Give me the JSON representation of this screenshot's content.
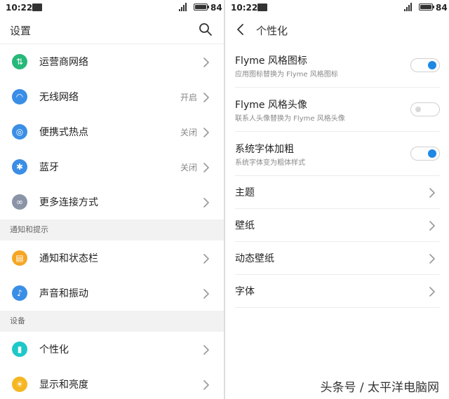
{
  "status_bar": {
    "time": "10:22",
    "battery": "84"
  },
  "left": {
    "title": "设置",
    "items": [
      {
        "label": "运营商网络",
        "value": "",
        "icon": "mobile-data-icon",
        "color": "#27b87a"
      },
      {
        "label": "无线网络",
        "value": "开启",
        "icon": "wifi-icon",
        "color": "#3a8ee6"
      },
      {
        "label": "便携式热点",
        "value": "关闭",
        "icon": "hotspot-icon",
        "color": "#3a8ee6"
      },
      {
        "label": "蓝牙",
        "value": "关闭",
        "icon": "bluetooth-icon",
        "color": "#3a8ee6"
      },
      {
        "label": "更多连接方式",
        "value": "",
        "icon": "link-icon",
        "color": "#8a94a6"
      }
    ],
    "section_notify": "通知和提示",
    "notify_items": [
      {
        "label": "通知和状态栏",
        "icon": "notification-icon",
        "color": "#f5a623"
      },
      {
        "label": "声音和振动",
        "icon": "volume-icon",
        "color": "#3a8ee6"
      }
    ],
    "section_device": "设备",
    "device_items": [
      {
        "label": "个性化",
        "icon": "personalize-icon",
        "color": "#1fc8c8"
      },
      {
        "label": "显示和亮度",
        "icon": "brightness-icon",
        "color": "#f5b623"
      }
    ]
  },
  "right": {
    "title": "个性化",
    "toggles": [
      {
        "title": "Flyme 风格图标",
        "subtitle": "应用图标替换为 Flyme 风格图标",
        "on": true
      },
      {
        "title": "Flyme 风格头像",
        "subtitle": "联系人头像替换为 Flyme 风格头像",
        "on": false
      },
      {
        "title": "系统字体加粗",
        "subtitle": "系统字体变为粗体样式",
        "on": true
      }
    ],
    "nav_items": [
      "主题",
      "壁纸",
      "动态壁纸",
      "字体"
    ]
  },
  "watermark": "头条号 / 太平洋电脑网",
  "colors": {
    "accent": "#1e88e5",
    "section_bg": "#f2f2f2"
  }
}
